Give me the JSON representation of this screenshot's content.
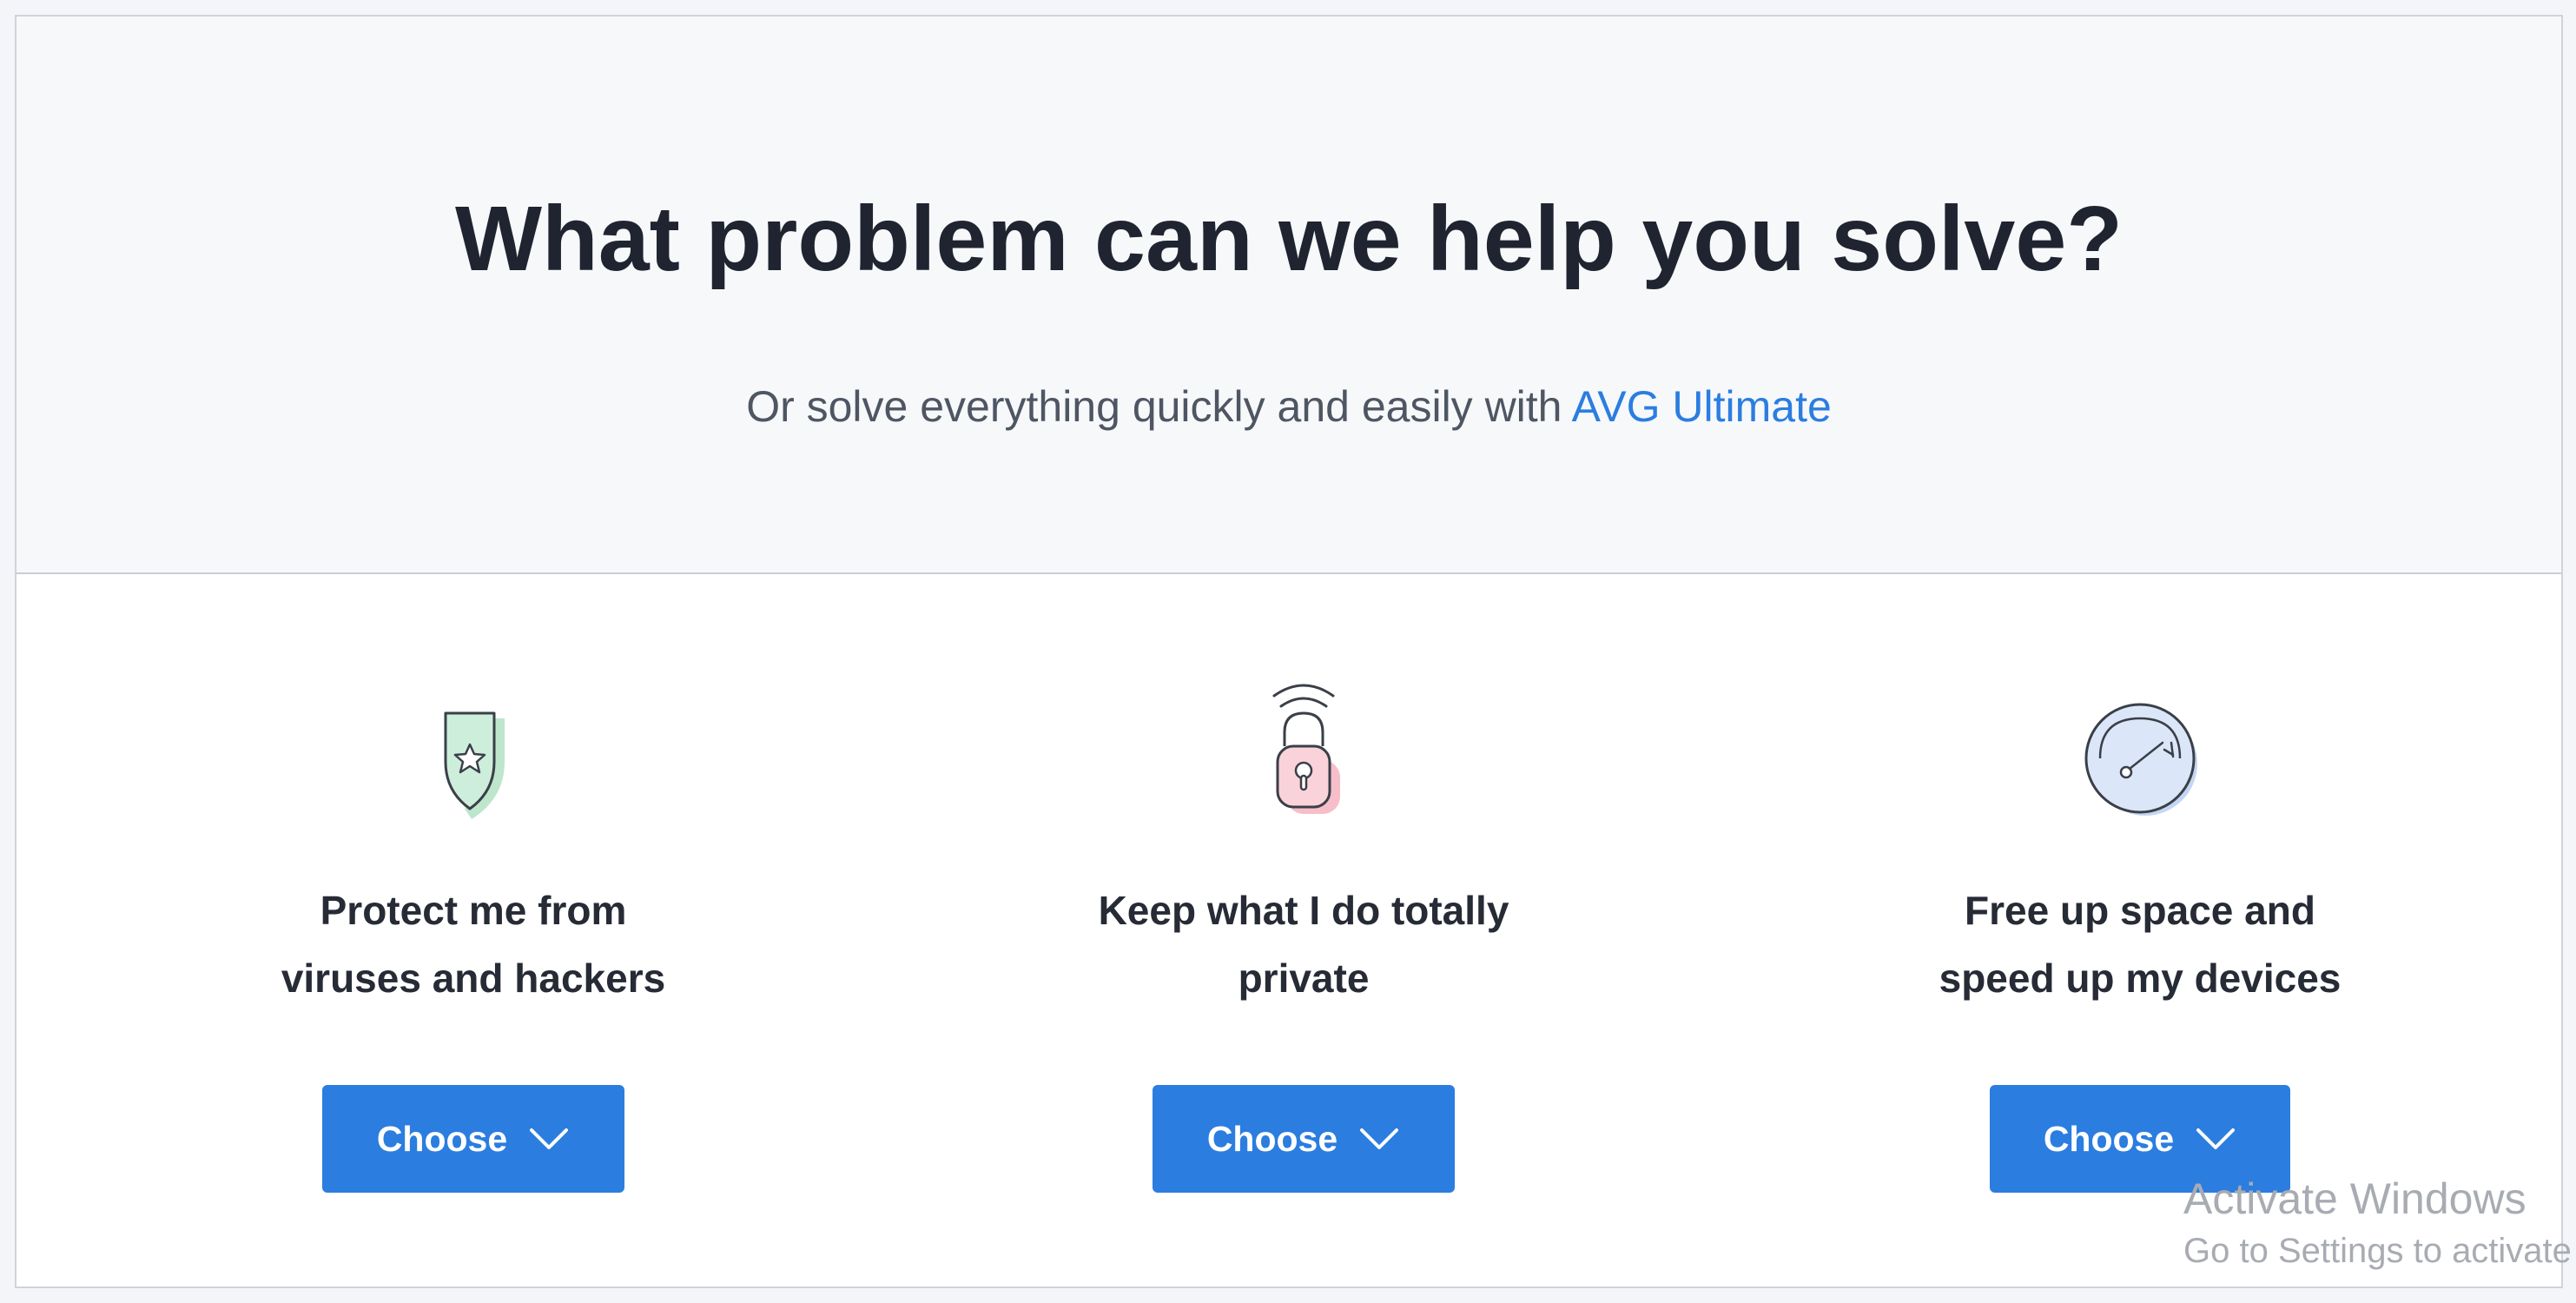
{
  "hero": {
    "title": "What problem can we help you solve?",
    "subtitle_prefix": "Or solve everything quickly and easily with",
    "subtitle_link": "AVG Ultimate",
    "link_color": "#2b7de0"
  },
  "cards": [
    {
      "icon": "shield-star-icon",
      "title": "Protect me from\nviruses and hackers",
      "button_label": "Choose",
      "accent": "#b6e3c8"
    },
    {
      "icon": "lock-wifi-icon",
      "title": "Keep what I do totally\nprivate",
      "button_label": "Choose",
      "accent": "#f5b3bf"
    },
    {
      "icon": "speedometer-icon",
      "title": "Free up space and\nspeed up my devices",
      "button_label": "Choose",
      "accent": "#bcd2f2"
    }
  ],
  "colors": {
    "button": "#2b7de0",
    "heading": "#1f2430",
    "hero_bg": "#f7f8fa"
  },
  "watermark": {
    "title": "Activate Windows",
    "subtitle": "Go to Settings to activate W"
  }
}
